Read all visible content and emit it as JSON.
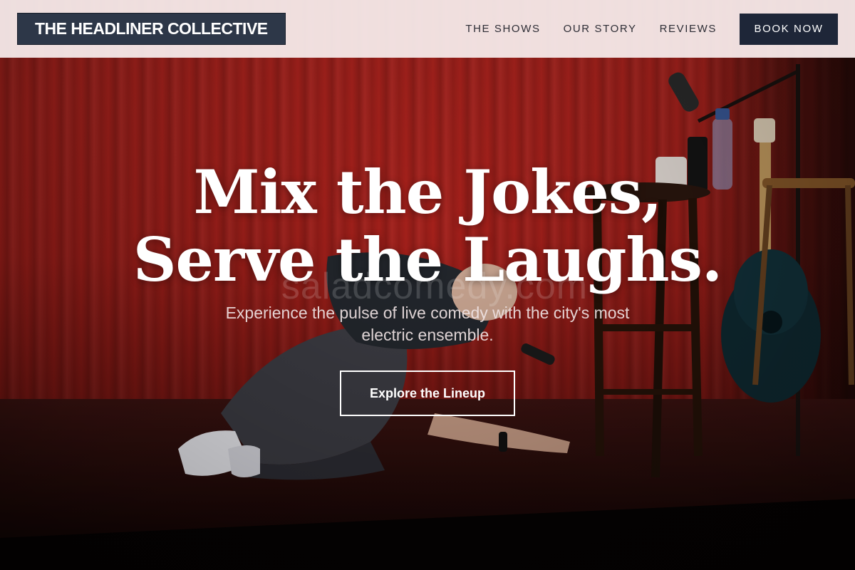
{
  "header": {
    "brand": "THE HEADLINER COLLECTIVE",
    "nav": [
      {
        "label": "THE SHOWS"
      },
      {
        "label": "OUR STORY"
      },
      {
        "label": "REVIEWS"
      }
    ],
    "cta_label": "BOOK NOW"
  },
  "hero": {
    "headline_line1": "Mix the Jokes,",
    "headline_line2": "Serve the Laughs.",
    "watermark": "saladcomedy.com",
    "subtitle": "Experience the pulse of live comedy with the city's most electric ensemble.",
    "cta_label": "Explore the Lineup",
    "background": "comedian performing on stage in front of red curtain"
  },
  "colors": {
    "header_bg": "#f8eeee",
    "brand_bg": "#2d3748",
    "book_btn_bg": "#1e2638",
    "curtain_red": "#a21f1a",
    "text_white": "#ffffff"
  }
}
